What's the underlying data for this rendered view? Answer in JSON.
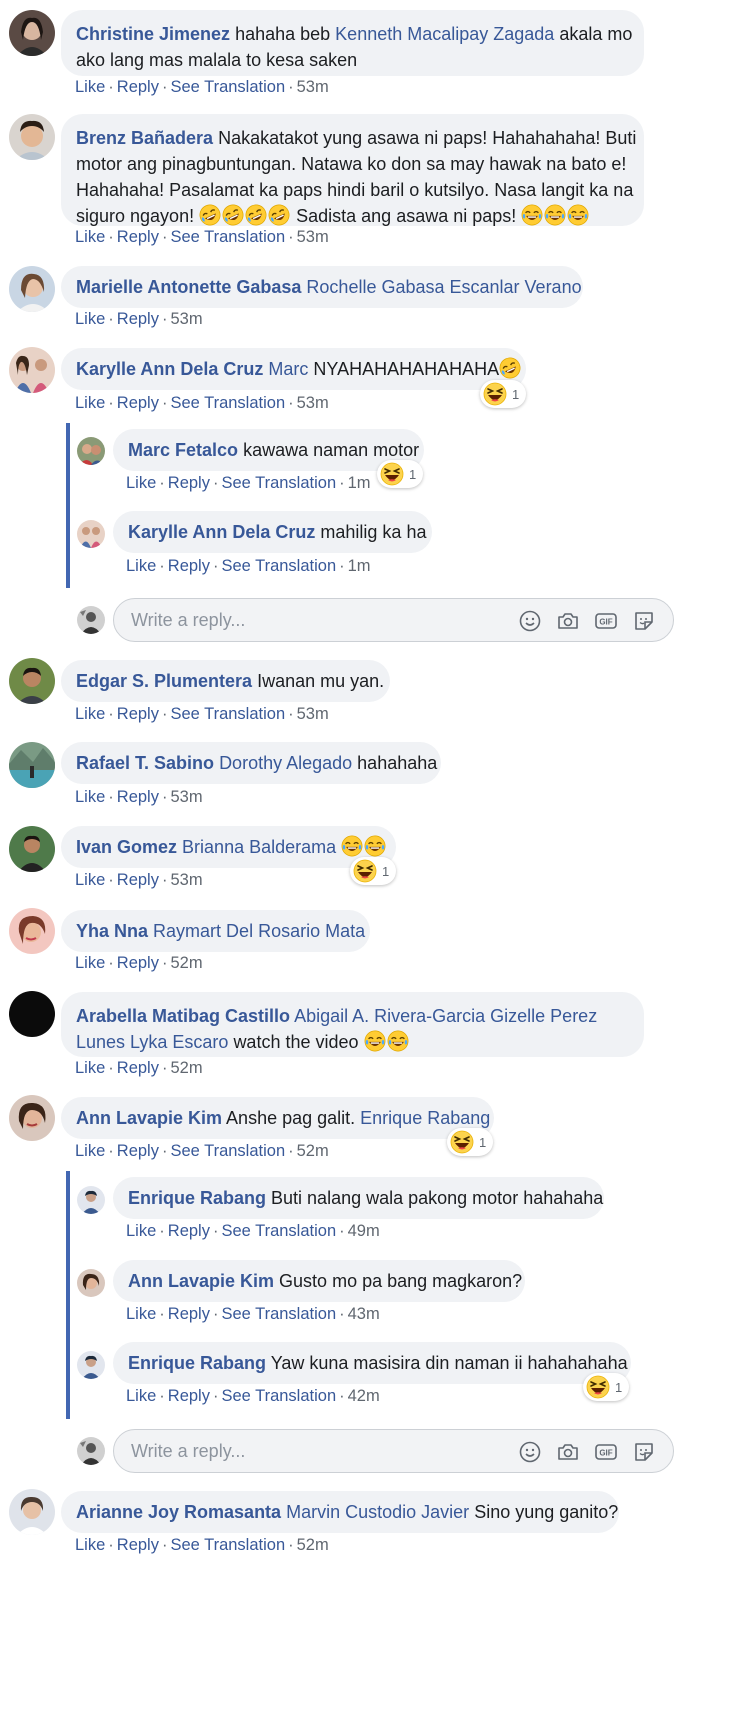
{
  "actions": {
    "like": "Like",
    "reply": "Reply",
    "see_translation": "See Translation"
  },
  "reply_box": {
    "placeholder": "Write a reply..."
  },
  "comments": [
    {
      "author": "Christine Jimenez",
      "segments": [
        "hahaha beb ",
        "Kenneth Macalipay Zagada",
        " akala mo"
      ],
      "line2": "ako lang mas malala to kesa saken",
      "time": "53m",
      "translation": true
    },
    {
      "author": "Brenz Bañadera",
      "lines": [
        "Nakakatakot yung asawa ni paps! Hahahahaha! Buti",
        "motor ang pinagbuntungan. Natawa ko don sa may hawak na bato e!",
        "Hahahaha! Pasalamat ka paps hindi baril o kutsilyo. Nasa langit ka na",
        "siguro ngayon!"
      ],
      "line4_tail": "Sadista ang asawa ni paps!",
      "time": "53m",
      "translation": true
    },
    {
      "author": "Marielle Antonette Gabasa",
      "mention": "Rochelle Gabasa Escanlar Verano",
      "time": "53m",
      "translation": false
    },
    {
      "author": "Karylle Ann Dela Cruz",
      "mention": "Marc",
      "text": "NYAHAHAHAHAHAHA",
      "time": "53m",
      "translation": true,
      "reaction_count": "1"
    },
    {
      "author": "Marc Fetalco",
      "text": "kawawa naman motor",
      "time": "1m",
      "translation": true,
      "reaction_count": "1"
    },
    {
      "author": "Karylle Ann Dela Cruz",
      "text": "mahilig ka ha",
      "time": "1m",
      "translation": true
    },
    {
      "author": "Edgar S. Plumentera",
      "text": "Iwanan mu yan.",
      "time": "53m",
      "translation": true
    },
    {
      "author": "Rafael T. Sabino",
      "mention": "Dorothy Alegado",
      "text": "hahahaha",
      "time": "53m",
      "translation": false
    },
    {
      "author": "Ivan Gomez",
      "mention": "Brianna Balderama",
      "time": "53m",
      "translation": false,
      "reaction_count": "1"
    },
    {
      "author": "Yha Nna",
      "mention": "Raymart Del Rosario Mata",
      "time": "52m",
      "translation": false
    },
    {
      "author": "Arabella Matibag Castillo",
      "mention": "Abigail A. Rivera-Garcia Gizelle Perez",
      "mention2": "Lunes Lyka Escaro",
      "text": "watch the video",
      "time": "52m",
      "translation": false
    },
    {
      "author": "Ann Lavapie Kim",
      "text": "Anshe pag galit.",
      "mention": "Enrique Rabang",
      "time": "52m",
      "translation": true,
      "reaction_count": "1"
    },
    {
      "author": "Enrique Rabang",
      "text": "Buti nalang wala pakong motor hahahaha",
      "time": "49m",
      "translation": true
    },
    {
      "author": "Ann Lavapie Kim",
      "text": "Gusto mo pa bang magkaron?",
      "time": "43m",
      "translation": true
    },
    {
      "author": "Enrique Rabang",
      "text": "Yaw kuna masisira din naman ii hahahahaha",
      "time": "42m",
      "translation": true,
      "reaction_count": "1"
    },
    {
      "author": "Arianne Joy Romasanta",
      "mention": "Marvin Custodio Javier",
      "text": "Sino yung ganito?",
      "time": "52m",
      "translation": true
    }
  ],
  "colors": {
    "link": "#385898",
    "bubble": "#f0f2f5",
    "meta": "#606770",
    "thread": "#4267b2"
  },
  "icons": [
    "smiley-icon",
    "camera-icon",
    "gif-icon",
    "sticker-icon",
    "laughing-tears-emoji",
    "rofl-emoji",
    "haha-reaction-icon"
  ]
}
